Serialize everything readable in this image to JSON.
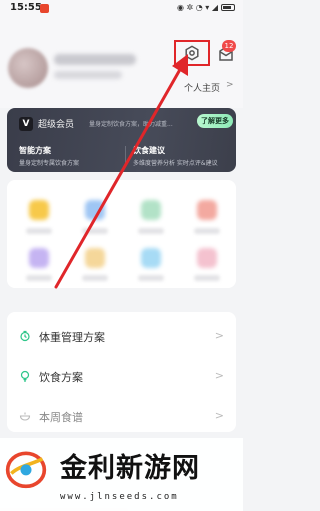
{
  "status_bar": {
    "time": "15:55",
    "indicators": "◉ ✲ ◔ ▾ ◢"
  },
  "header": {
    "homepage_label": "个人主页",
    "homepage_chevron": ">",
    "mail_badge": "12",
    "settings_highlight_color": "#e0262a"
  },
  "vip": {
    "logo": "V",
    "title": "超级会员",
    "description": "量身定制饮食方案，助力减重...",
    "button": "了解更多",
    "col1_title": "智能方案",
    "col1_desc": "量身定制专属饮食方案",
    "col2_title": "饮食建议",
    "col2_desc": "多维度营养分析  实时点评&建议"
  },
  "list": {
    "items": [
      {
        "label": "体重管理方案",
        "icon": "clock-icon",
        "chevron": ">"
      },
      {
        "label": "饮食方案",
        "icon": "bulb-icon",
        "chevron": ">"
      },
      {
        "label": "本周食谱",
        "icon": "bowl-icon",
        "chevron": ">"
      }
    ]
  },
  "watermark": {
    "title": "金利新游网",
    "url": "www.jlnseeds.com"
  },
  "colors": {
    "accent_green": "#2fc68a",
    "annotation_red": "#e0262a"
  }
}
